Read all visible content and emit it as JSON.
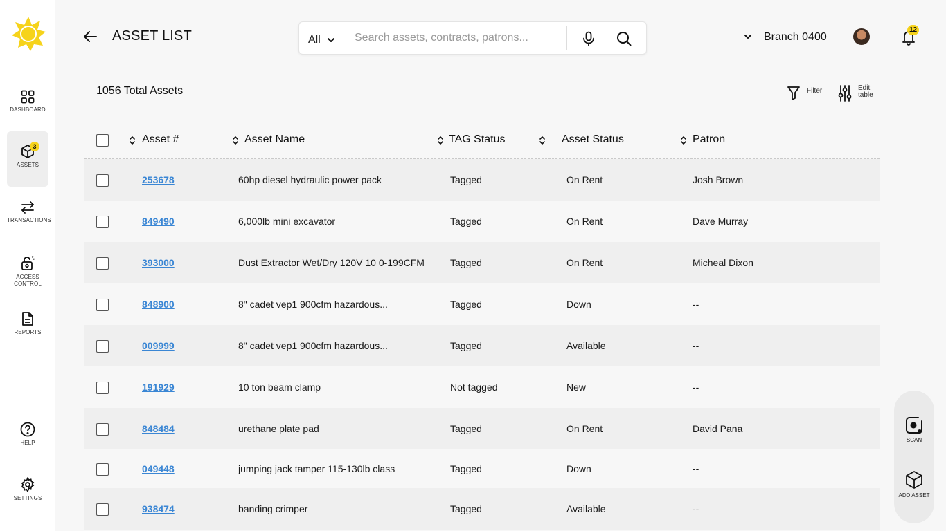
{
  "colors": {
    "accent": "#f6d31b",
    "link": "#3a86d4"
  },
  "sidebar": {
    "logo": "sun-logo-icon",
    "items": [
      {
        "label": "DASHBOARD",
        "icon": "grid-icon"
      },
      {
        "label": "ASSETS",
        "icon": "cube-icon",
        "badge": "3",
        "active": true
      },
      {
        "label": "TRANSACTIONS",
        "icon": "swap-arrows-icon"
      },
      {
        "label": "ACCESS CONTROL",
        "icon": "lock-icon"
      },
      {
        "label": "REPORTS",
        "icon": "document-icon"
      },
      {
        "label": "HELP",
        "icon": "help-icon"
      },
      {
        "label": "SETTINGS",
        "icon": "gear-icon"
      }
    ]
  },
  "header": {
    "title": "ASSET LIST",
    "search": {
      "scope": "All",
      "placeholder": "Search assets, contracts, patrons..."
    },
    "branch": "Branch 0400",
    "notifications": "12"
  },
  "summary": {
    "total": "1056 Total Assets"
  },
  "tools": {
    "filter": "Filter",
    "edit_line1": "Edit",
    "edit_line2": "table"
  },
  "table": {
    "columns": [
      "Asset #",
      "Asset Name",
      "TAG Status",
      "Asset Status",
      "Patron"
    ],
    "rows": [
      {
        "asset": "253678",
        "name": "60hp diesel hydraulic power pack",
        "tag": "Tagged",
        "status": "On Rent",
        "patron": "Josh Brown"
      },
      {
        "asset": "849490",
        "name": "6,000lb mini excavator",
        "tag": "Tagged",
        "status": "On Rent",
        "patron": "Dave Murray"
      },
      {
        "asset": "393000",
        "name": "Dust Extractor Wet/Dry 120V 10 0-199CFM",
        "tag": "Tagged",
        "status": "On Rent",
        "patron": "Micheal Dixon"
      },
      {
        "asset": "848900",
        "name": "8\" cadet vep1 900cfm hazardous...",
        "tag": "Tagged",
        "status": "Down",
        "patron": "--"
      },
      {
        "asset": "009999",
        "name": "8\" cadet vep1 900cfm hazardous...",
        "tag": "Tagged",
        "status": "Available",
        "patron": "--"
      },
      {
        "asset": "191929",
        "name": "10 ton beam clamp",
        "tag": "Not tagged",
        "status": "New",
        "patron": "--"
      },
      {
        "asset": "848484",
        "name": "urethane plate pad",
        "tag": "Tagged",
        "status": "On Rent",
        "patron": "David Pana"
      },
      {
        "asset": "049448",
        "name": "jumping jack tamper 115-130lb class",
        "tag": "Tagged",
        "status": "Down",
        "patron": "--"
      },
      {
        "asset": "938474",
        "name": "banding crimper",
        "tag": "Tagged",
        "status": "Available",
        "patron": "--"
      }
    ]
  },
  "fab": {
    "scan": "SCAN",
    "add_asset": "ADD ASSET"
  }
}
